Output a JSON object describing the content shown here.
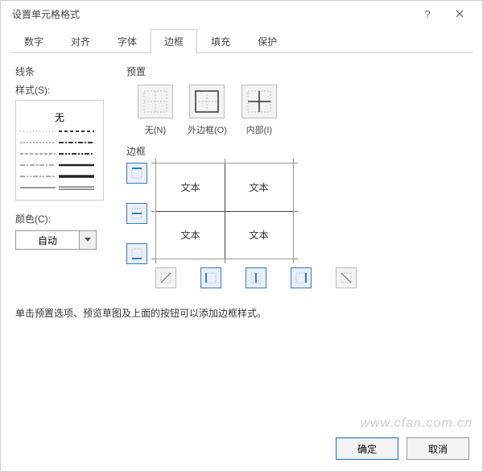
{
  "window": {
    "title": "设置单元格格式"
  },
  "tabs": {
    "number": "数字",
    "alignment": "对齐",
    "font": "字体",
    "border": "边框",
    "fill": "填充",
    "protection": "保护",
    "active": "border"
  },
  "line": {
    "group": "线条",
    "style_label": "样式(S):",
    "none": "无"
  },
  "color": {
    "label": "颜色(C):",
    "value": "自动"
  },
  "presets": {
    "group": "预置",
    "none": "无(N)",
    "outline": "外边框(O)",
    "inside": "内部(I)"
  },
  "border": {
    "group": "边框",
    "sample_text": "文本"
  },
  "hint": "单击预置选项、预览草图及上面的按钮可以添加边框样式。",
  "footer": {
    "ok": "确定",
    "cancel": "取消"
  },
  "watermark": "www.cfan.com.cn"
}
